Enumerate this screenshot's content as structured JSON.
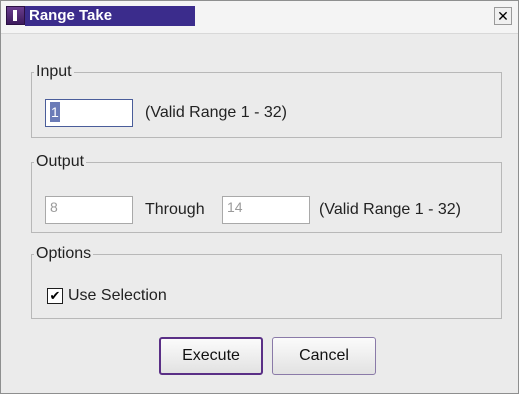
{
  "window": {
    "title": "Range Take",
    "close_glyph": "✕",
    "icon": "app-icon"
  },
  "input_group": {
    "legend": "Input",
    "value": "1",
    "hint": "(Valid Range 1 - 32)"
  },
  "output_group": {
    "legend": "Output",
    "from_value": "8",
    "through_label": "Through",
    "to_value": "14",
    "hint": "(Valid Range 1 - 32)"
  },
  "options_group": {
    "legend": "Options",
    "use_selection_label": "Use Selection",
    "use_selection_checked": true,
    "check_glyph": "✔"
  },
  "buttons": {
    "execute": "Execute",
    "cancel": "Cancel"
  },
  "colors": {
    "title_highlight": "#3b2c8c",
    "default_button_border": "#5a2f86",
    "window_bg": "#ebebeb"
  }
}
